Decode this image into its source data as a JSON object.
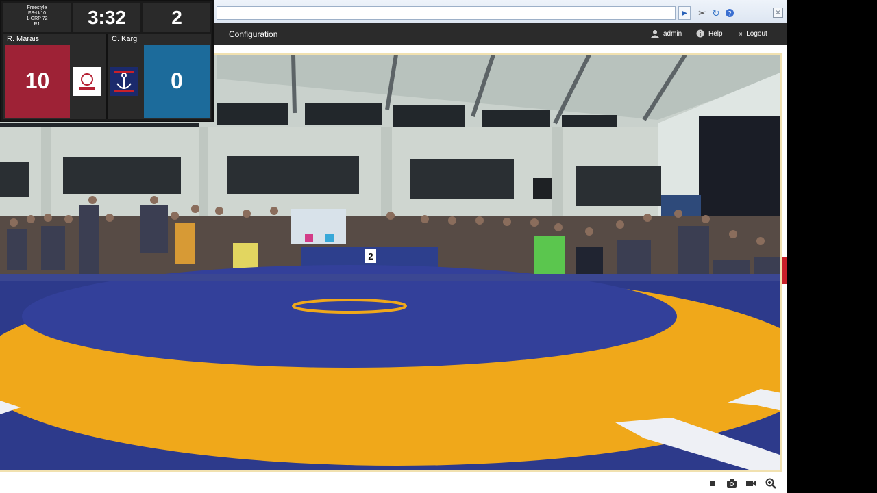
{
  "browser": {
    "address_value": "",
    "go_icon": "play-arrow-icon",
    "tools": [
      "tools-icon",
      "refresh-icon",
      "help-circle-icon"
    ],
    "close_icon": "close-icon"
  },
  "nav": {
    "title": "Configuration",
    "user_label": "admin",
    "help_label": "Help",
    "logout_label": "Logout"
  },
  "scoreboard": {
    "info_line1": "Freestyle",
    "info_line2": "FS-U/10",
    "info_line3": "1-GRP 72",
    "info_line4": "R1",
    "clock": "3:32",
    "period": "2",
    "red_name": "R. Marais",
    "red_score": "10",
    "blue_name": "C. Karg",
    "blue_score": "0"
  },
  "scene": {
    "table_number": "2"
  },
  "controls": [
    "stop-icon",
    "camera-icon",
    "record-icon",
    "zoom-in-icon"
  ],
  "colors": {
    "red_corner": "#9e2236",
    "blue_corner": "#1c6b9b",
    "mat_blue": "#2c3a8a",
    "mat_yellow": "#f0a81a"
  }
}
